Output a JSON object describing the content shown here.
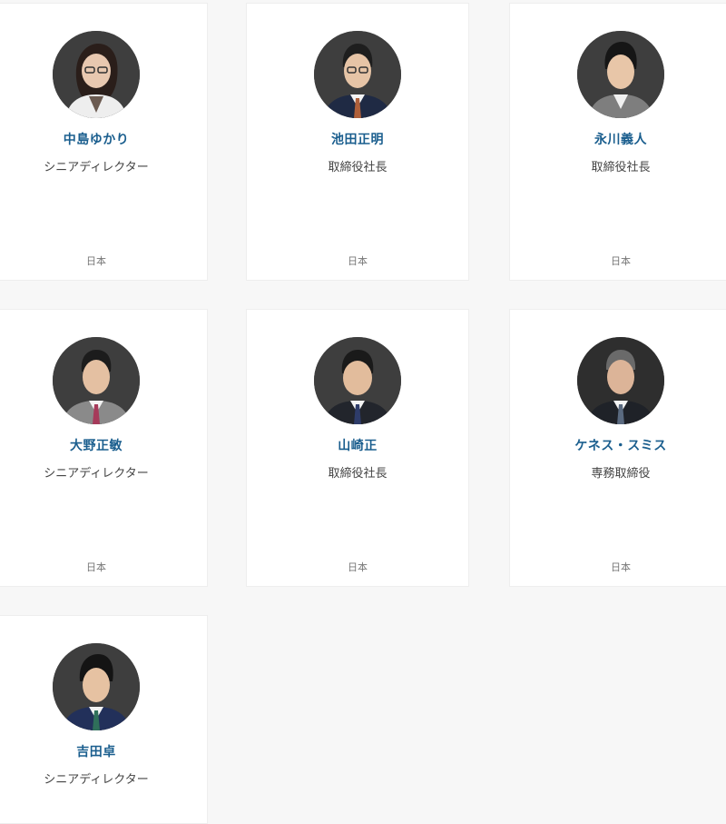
{
  "people": [
    {
      "name": "中島ゆかり",
      "role": "シニアディレクター",
      "country": "日本",
      "avatar_icon": "person-woman-icon"
    },
    {
      "name": "池田正明",
      "role": "取締役社長",
      "country": "日本",
      "avatar_icon": "person-man-icon"
    },
    {
      "name": "永川義人",
      "role": "取締役社長",
      "country": "日本",
      "avatar_icon": "person-man-icon"
    },
    {
      "name": "大野正敏",
      "role": "シニアディレクター",
      "country": "日本",
      "avatar_icon": "person-man-icon"
    },
    {
      "name": "山崎正",
      "role": "取締役社長",
      "country": "日本",
      "avatar_icon": "person-man-icon"
    },
    {
      "name": "ケネス・スミス",
      "role": "専務取締役",
      "country": "日本",
      "avatar_icon": "person-man-icon"
    },
    {
      "name": "吉田卓",
      "role": "シニアディレクター",
      "country": "",
      "avatar_icon": "person-man-icon"
    }
  ],
  "colors": {
    "name_text": "#1a5e8e",
    "card_bg": "#ffffff",
    "page_bg": "#f7f7f7"
  }
}
